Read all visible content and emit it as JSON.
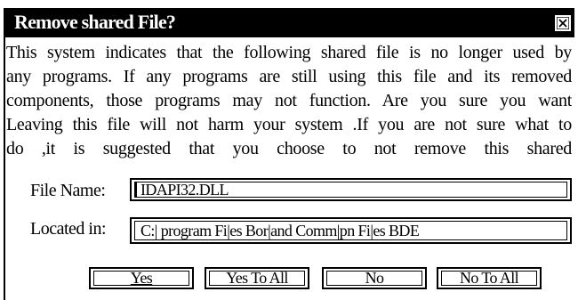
{
  "dialog": {
    "title": "Remove shared File?",
    "message_lines": [
      "This system indicates that the following shared file is no longer used by",
      "any programs. If any programs are still using this file and its removed",
      "components, those programs may not function. Are you sure you want",
      "Leaving this file will not harm your system .If you are not sure what to",
      "do ,it is suggested that you choose to not remove this shared"
    ],
    "file_name_label": "File Name:",
    "file_name_value": "IDAPI32.DLL",
    "located_in_label": "Located in:",
    "located_in_value": "C:| program Fi|es Bor|and Comm|pn Fi|es BDE",
    "buttons": {
      "yes": "Yes",
      "yes_to_all": "Yes To All",
      "no": "No",
      "no_to_all": "No To All"
    }
  },
  "colors": {
    "titlebar_bg": "#000000",
    "titlebar_text": "#ffffff",
    "dialog_bg": "#ffffff"
  },
  "icons": {
    "close": "close-icon"
  }
}
